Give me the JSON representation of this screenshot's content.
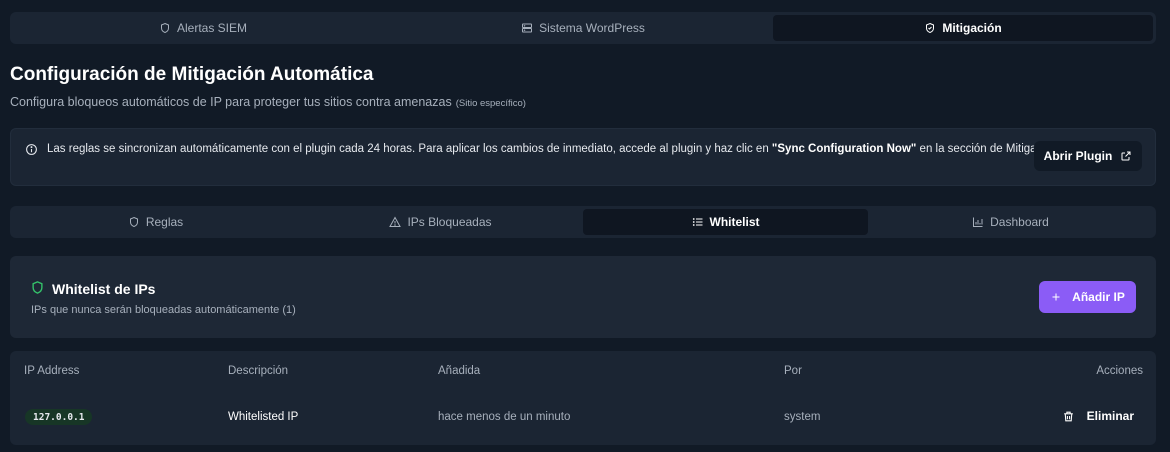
{
  "top_tabs": [
    {
      "label": "Alertas SIEM",
      "icon": "shield-icon",
      "active": false
    },
    {
      "label": "Sistema WordPress",
      "icon": "server-icon",
      "active": false
    },
    {
      "label": "Mitigación",
      "icon": "shield-check-icon",
      "active": true
    }
  ],
  "header": {
    "title": "Configuración de Mitigación Automática",
    "subtitle": "Configura bloqueos automáticos de IP para proteger tus sitios contra amenazas",
    "subtitle_note": "(Sitio específico)"
  },
  "banner": {
    "text_before": "Las reglas se sincronizan automáticamente con el plugin cada 24 horas. Para aplicar los cambios de inmediato, accede al plugin y haz clic en ",
    "text_bold": "\"Sync Configuration Now\"",
    "text_after": " en la sección de Mitigation.",
    "button_label": "Abrir Plugin"
  },
  "sub_tabs": [
    {
      "label": "Reglas",
      "icon": "shield-icon",
      "active": false
    },
    {
      "label": "IPs Bloqueadas",
      "icon": "warning-icon",
      "active": false
    },
    {
      "label": "Whitelist",
      "icon": "list-icon",
      "active": true
    },
    {
      "label": "Dashboard",
      "icon": "bar-chart-icon",
      "active": false
    }
  ],
  "whitelist": {
    "title": "Whitelist de IPs",
    "subtitle": "IPs que nunca serán bloqueadas automáticamente (1)",
    "add_label": "Añadir IP"
  },
  "table": {
    "headers": [
      "IP Address",
      "Descripción",
      "Añadida",
      "Por",
      "Acciones"
    ],
    "rows": [
      {
        "ip": "127.0.0.1",
        "description": "Whitelisted IP",
        "added": "hace menos de un minuto",
        "by": "system",
        "action": "Eliminar"
      }
    ]
  },
  "colors": {
    "background": "#111a26",
    "accent": "#8b5cf6",
    "success": "#34c26a"
  }
}
